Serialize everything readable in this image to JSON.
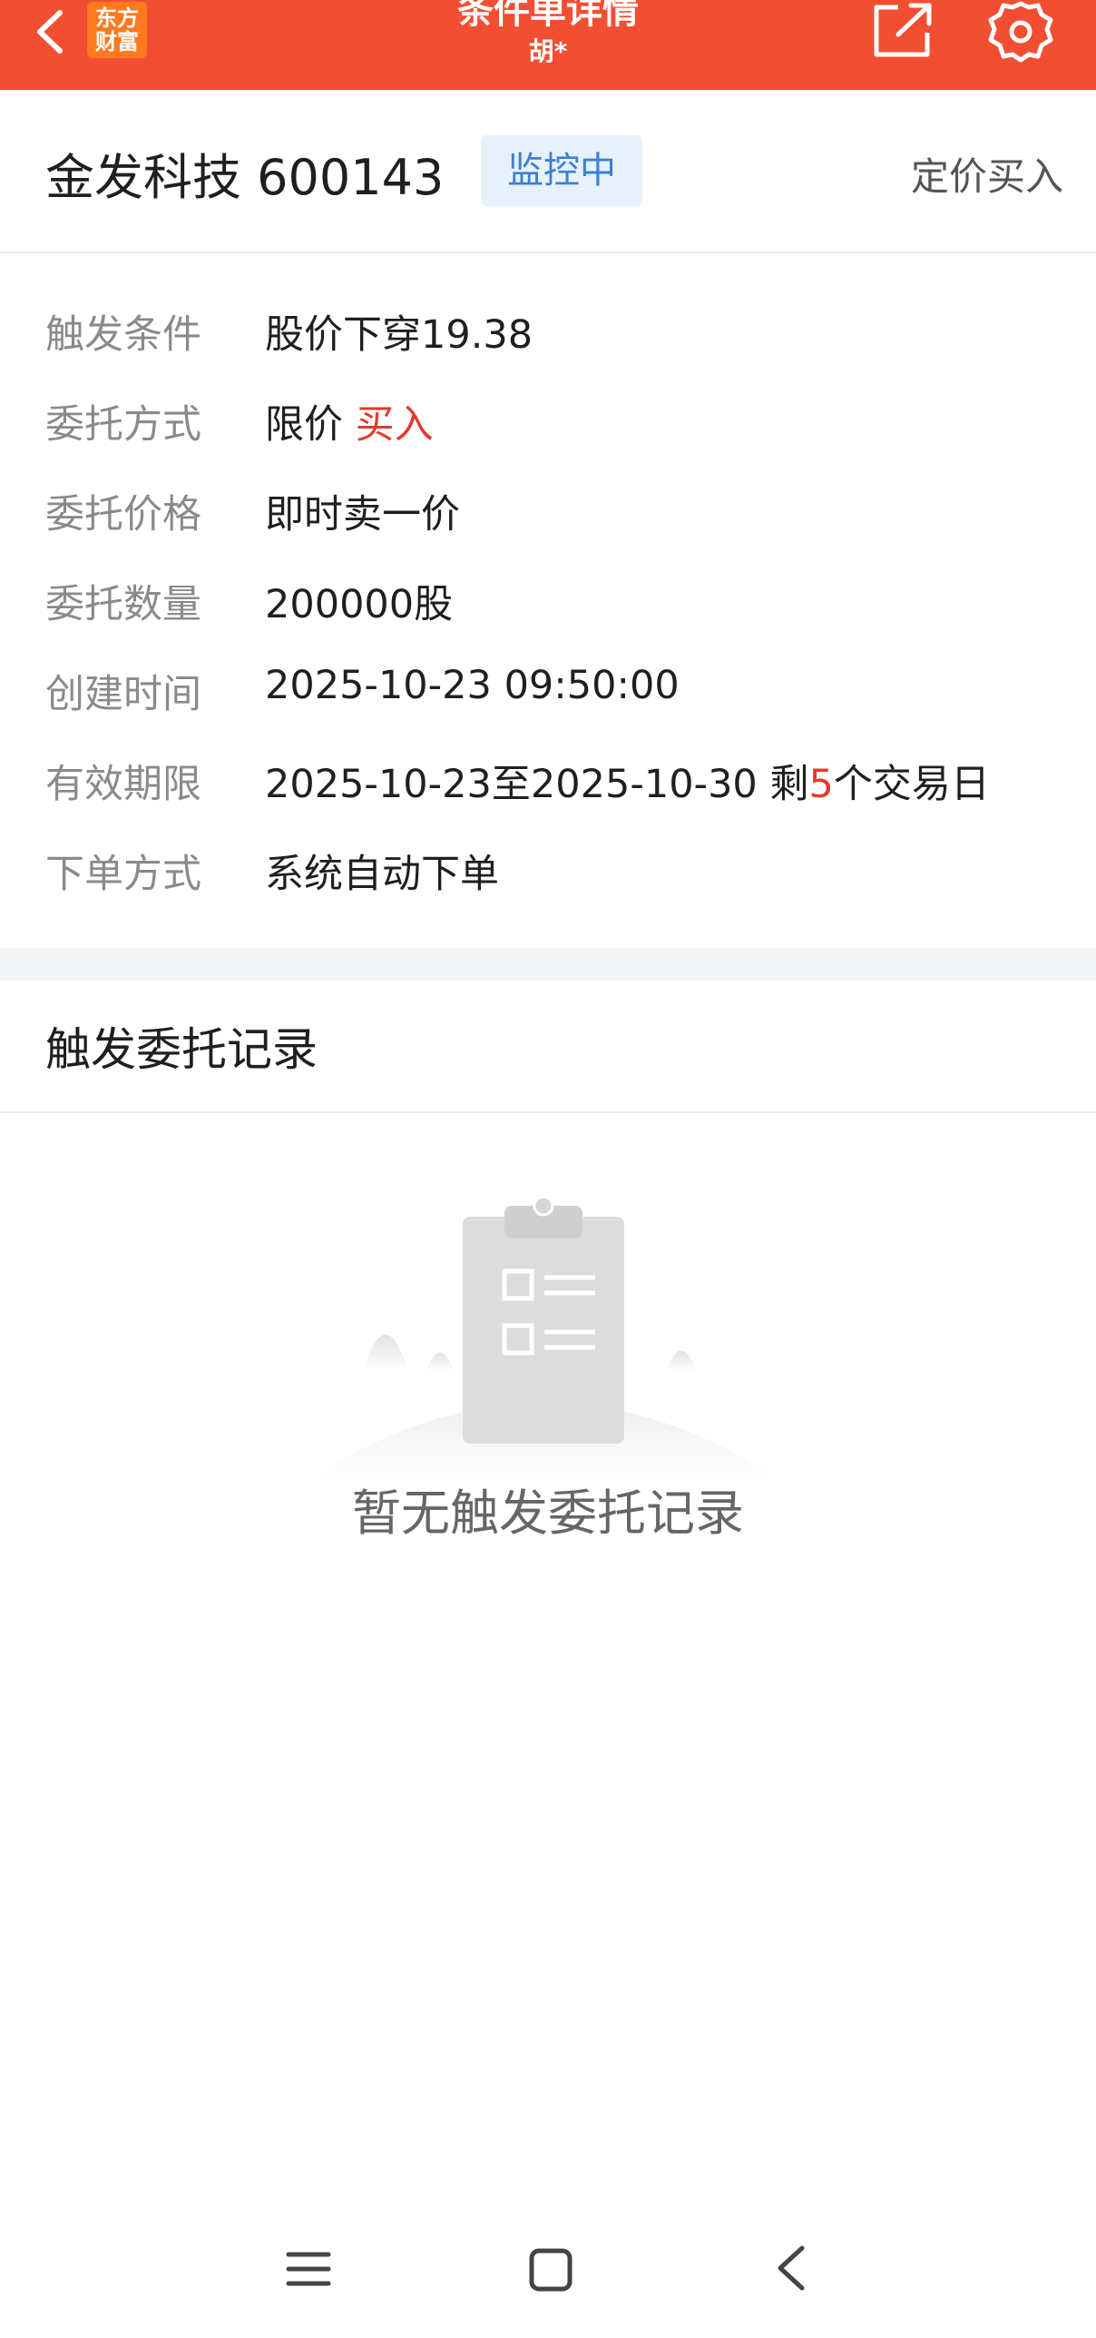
{
  "header": {
    "title": "条件单详情",
    "subtitle": "胡*",
    "logo_line1": "东方",
    "logo_line2": "财富",
    "back_icon": "chevron-left-icon",
    "share_icon": "share-icon",
    "settings_icon": "gear-icon"
  },
  "stock": {
    "name_code": "金发科技 600143",
    "status": "监控中",
    "order_type": "定价买入"
  },
  "details": {
    "trigger_label": "触发条件",
    "trigger_value": "股价下穿19.38",
    "method_label": "委托方式",
    "method_value": "限价",
    "method_side": "买入",
    "price_label": "委托价格",
    "price_value": "即时卖一价",
    "qty_label": "委托数量",
    "qty_value": "200000股",
    "created_label": "创建时间",
    "created_value": "2025-10-23 09:50:00",
    "validity_label": "有效期限",
    "validity_range": "2025-10-23至2025-10-30 剩",
    "validity_days": "5",
    "validity_suffix": "个交易日",
    "place_label": "下单方式",
    "place_value": "系统自动下单"
  },
  "records": {
    "title": "触发委托记录",
    "empty_text": "暂无触发委托记录",
    "empty_icon": "clipboard-icon"
  },
  "navbar": {
    "menu_icon": "menu-icon",
    "home_icon": "home-square-icon",
    "back_icon": "back-chevron-icon"
  },
  "colors": {
    "header_bg": "#f24e32",
    "logo_bg": "#ff7a1e",
    "badge_bg": "#e6f1fb",
    "badge_text": "#3e7fd0",
    "accent_red": "#e23a2a"
  }
}
